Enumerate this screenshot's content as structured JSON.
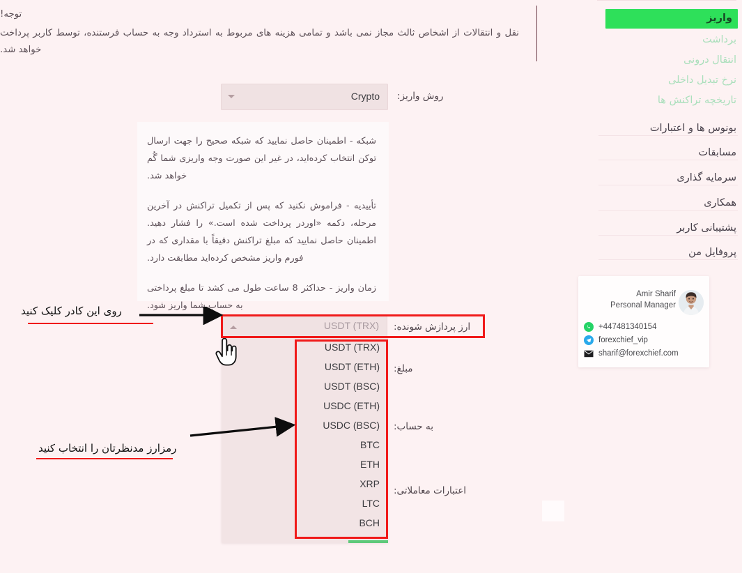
{
  "theme": {
    "page_bg": "#fdf2f3",
    "accent_green": "#2ee05a",
    "annotation_red": "#f01a1a",
    "panel_pink": "#f0e2e3"
  },
  "sidebar": {
    "items": [
      {
        "label": "واریز",
        "style": "active-green",
        "name": "deposit"
      },
      {
        "label": "برداشت",
        "style": "pale",
        "name": "withdrawal"
      },
      {
        "label": "انتقال درونی",
        "style": "pale",
        "name": "internal-transfer"
      },
      {
        "label": "نرخ تبدیل داخلی",
        "style": "pale",
        "name": "internal-exchange-rate"
      },
      {
        "label": "تاریخچه تراکنش ها",
        "style": "pale",
        "name": "transaction-history"
      },
      {
        "label": "بونوس ها و اعتبارات",
        "style": "dark",
        "name": "bonuses-and-credits"
      },
      {
        "label": "مسابقات",
        "style": "dark",
        "name": "contests"
      },
      {
        "label": "سرمایه گذاری",
        "style": "dark",
        "name": "investment"
      },
      {
        "label": "همکاری",
        "style": "dark",
        "name": "partnership"
      },
      {
        "label": "پشتیبانی کاربر",
        "style": "dark",
        "name": "user-support"
      },
      {
        "label": "پروفایل من",
        "style": "dark",
        "name": "my-profile"
      }
    ]
  },
  "manager_card": {
    "name": "Amir Sharif",
    "role": "Personal Manager",
    "contacts": [
      {
        "icon": "whatsapp-icon",
        "value": "+447481340154",
        "color": "#25d366"
      },
      {
        "icon": "telegram-icon",
        "value": "forexchief_vip",
        "color": "#29a9eb"
      },
      {
        "icon": "email-icon",
        "value": "sharif@forexchief.com",
        "color": "#1d1d1f"
      }
    ]
  },
  "notice": {
    "title": "توجه!",
    "body": "نقل و انتقالات از اشخاص ثالث مجاز نمی باشد و تمامی هزینه های مربوط به استرداد وجه به حساب فرستنده، توسط کاربر پرداخت خواهد شد."
  },
  "deposit_method": {
    "label": "روش واریز:",
    "value": "Crypto",
    "caret": "chevron-down-icon"
  },
  "instructions": [
    "شبکه - اطمینان حاصل نمایید که شبکه صحیح را جهت ارسال توکن انتخاب کرده‌اید، در غیر این صورت وجه واریزی شما گُم خواهد شد.",
    "تأییدیه - فراموش نکنید که پس از تکمیل تراکنش در آخرین مرحله، دکمه «اوردر پرداخت شده است.» را فشار دهید. اطمینان حاصل نمایید که مبلغ تراکنش دقیقاً با مقداری که در فورم واریز مشخص کرده‌اید مطابقت دارد.",
    "زمان واریز - حداکثر 8 ساعت طول می کشد تا مبلغ پرداختی به حساب شما واریز شود."
  ],
  "currency_field": {
    "label": "ارز پردازش شونده:",
    "value": "USDT (TRX)",
    "caret": "chevron-up-icon",
    "options": [
      "USDT (TRX)",
      "USDT (ETH)",
      "USDT (BSC)",
      "USDC (ETH)",
      "USDC (BSC)",
      "BTC",
      "ETH",
      "XRP",
      "LTC",
      "BCH"
    ]
  },
  "form_labels": {
    "amount": "مبلغ:",
    "to_account": "به حساب:",
    "trading_credits": "اعتبارات معاملاتی:"
  },
  "annotations": [
    {
      "text": "روی این کادر کلیک کنید",
      "name": "click-this-box-callout"
    },
    {
      "text": "رمزارز مدنظرتان را انتخاب کنید",
      "name": "select-your-crypto-callout"
    }
  ],
  "cursor": {
    "icon": "pointing-hand-cursor"
  }
}
